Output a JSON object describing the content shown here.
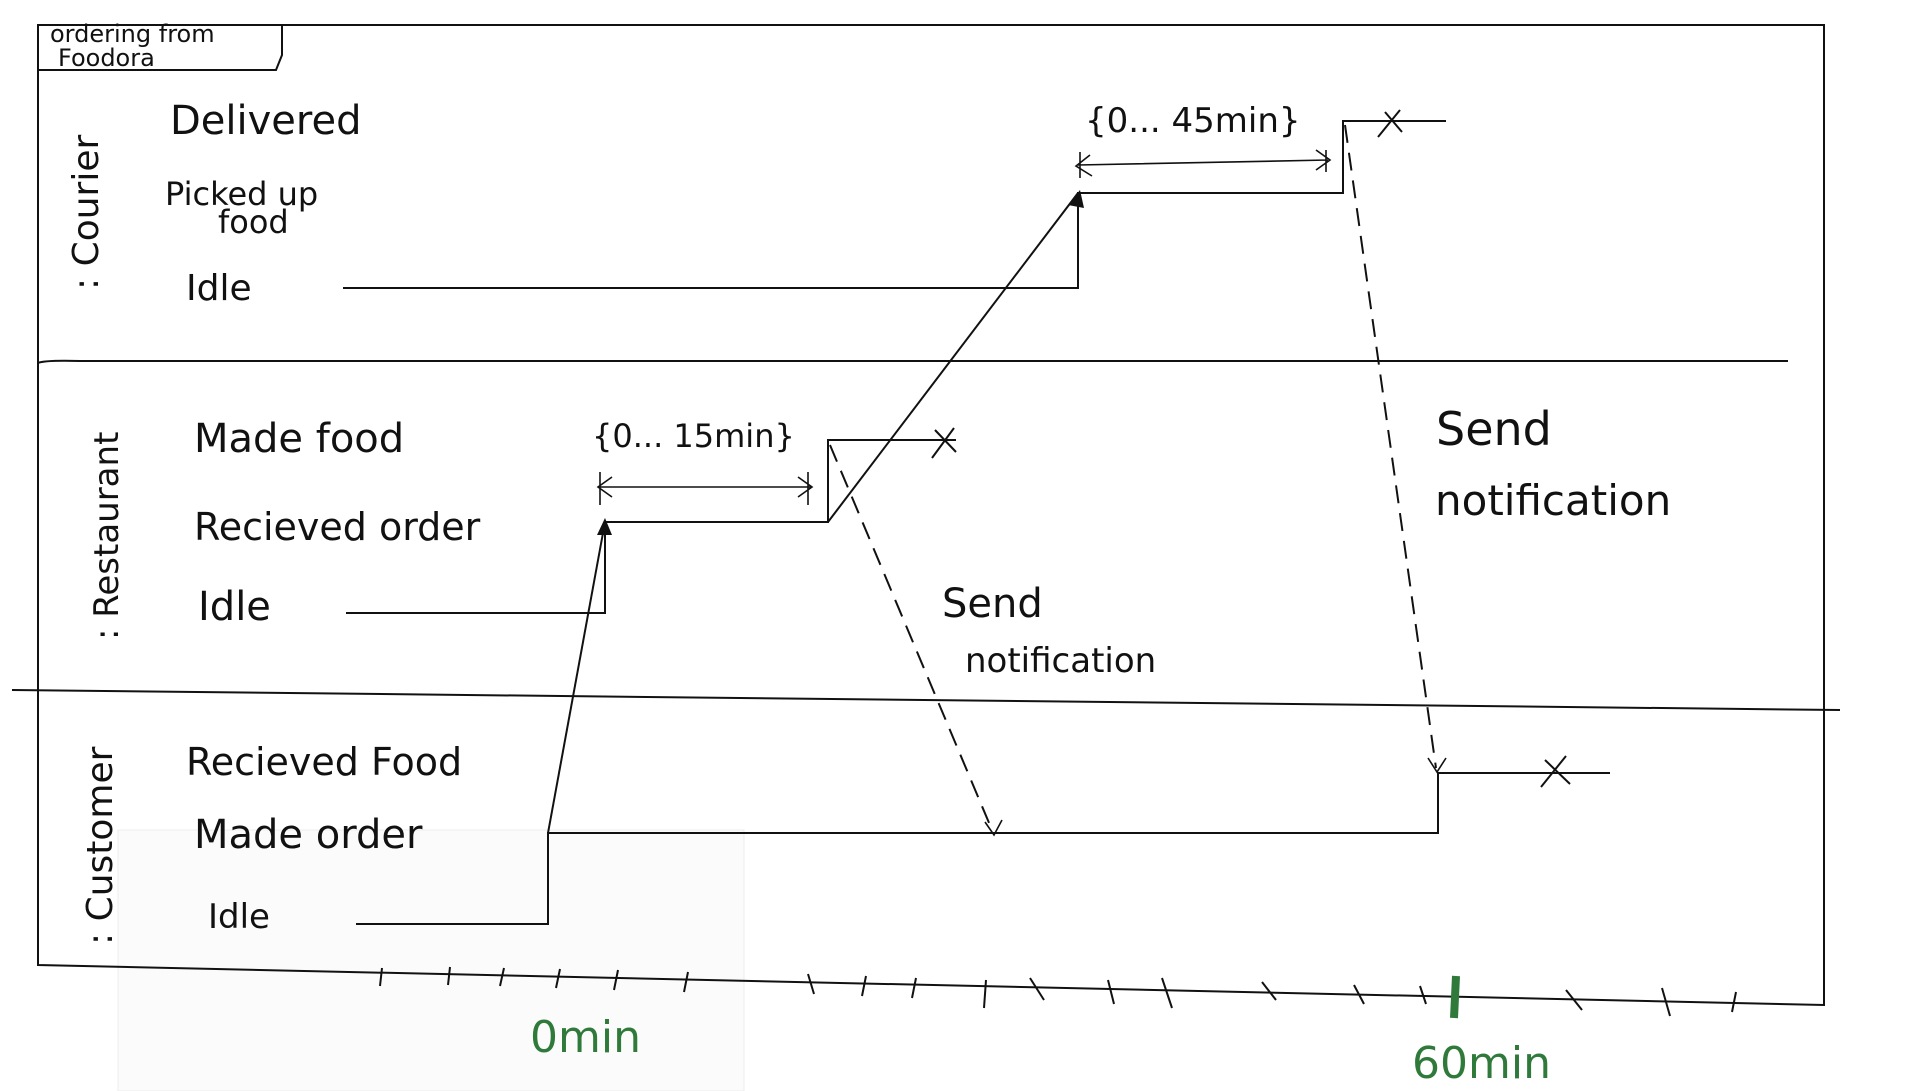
{
  "frame": {
    "title_line1": "ordering from",
    "title_line2": "Foodora"
  },
  "lanes": [
    {
      "name": ": Courier",
      "states": [
        "Delivered",
        "Picked up",
        "food",
        "Idle"
      ]
    },
    {
      "name": ": Restaurant",
      "states": [
        "Made food",
        "Recieved order",
        "Idle"
      ]
    },
    {
      "name": ": Customer",
      "states": [
        "Recieved Food",
        "Made order",
        "Idle"
      ]
    }
  ],
  "constraints": {
    "restaurant": "{0... 15min}",
    "courier": "{0... 45min}"
  },
  "messages": {
    "restaurant_to_customer_line1": "Send",
    "restaurant_to_customer_line2": "notification",
    "courier_to_customer_line1": "Send",
    "courier_to_customer_line2": "notification"
  },
  "time_axis": {
    "start_label": "0min",
    "end_label": "60min",
    "color": "#2f7a3a"
  }
}
